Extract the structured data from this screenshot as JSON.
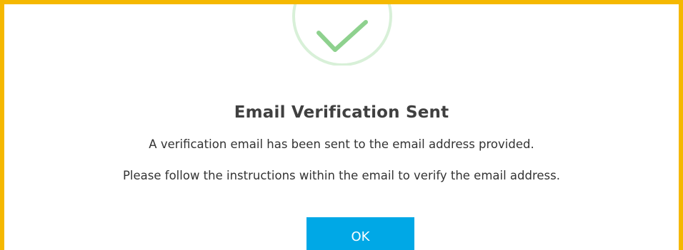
{
  "dialog": {
    "icon": "checkmark-success-icon",
    "title": "Email Verification Sent",
    "message_line_1": "A verification email has been sent to the email address provided.",
    "message_line_2": "Please follow the instructions within the email to verify the email address.",
    "ok_label": "OK"
  },
  "colors": {
    "border": "#f5b800",
    "check": "#8ed18e",
    "check_ring": "#d8f0d8",
    "button": "#00a8e6"
  }
}
